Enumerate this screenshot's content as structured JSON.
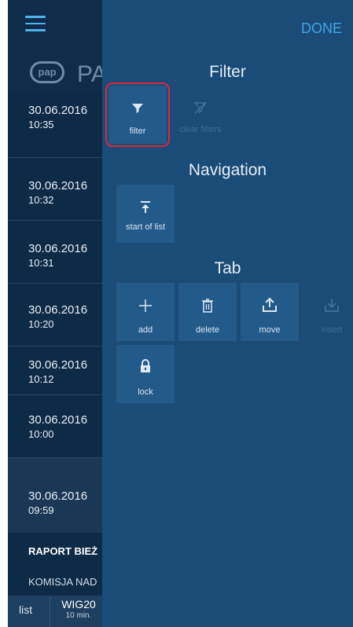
{
  "header": {
    "logo_text": "pap",
    "app_name": "PA"
  },
  "list": {
    "items": [
      {
        "date": "30.06.2016",
        "time": "10:35"
      },
      {
        "date": "30.06.2016",
        "time": "10:32"
      },
      {
        "date": "30.06.2016",
        "time": "10:31"
      },
      {
        "date": "30.06.2016",
        "time": "10:20"
      },
      {
        "date": "30.06.2016",
        "time": "10:12"
      },
      {
        "date": "30.06.2016",
        "time": "10:00"
      },
      {
        "date": "30.06.2016",
        "time": "09:59"
      }
    ],
    "headline1": "RAPORT BIEŻ",
    "headline2": "KOMISJA NAD"
  },
  "bottom_tabs": {
    "list": "list",
    "wig_title": "WIG20",
    "wig_sub": "10 min."
  },
  "panel": {
    "done_label": "DONE",
    "filter_title": "Filter",
    "filter_label": "filter",
    "clear_filters_label": "clear filters",
    "navigation_title": "Navigation",
    "start_of_list_label": "start of list",
    "tab_title": "Tab",
    "add_label": "add",
    "delete_label": "delete",
    "move_label": "move",
    "insert_label": "insert",
    "lock_label": "lock"
  },
  "colors": {
    "panel_bg": "#1b4c78",
    "tile_bg": "#225a8a",
    "accent": "#3ea6e8",
    "highlight_border": "#e0263a"
  }
}
